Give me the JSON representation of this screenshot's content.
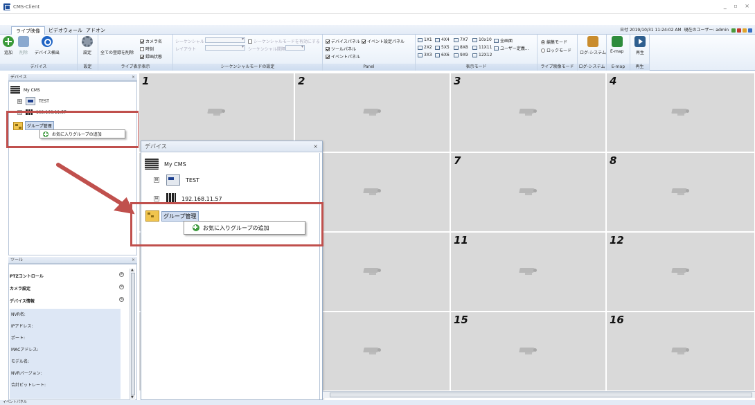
{
  "window": {
    "title": "CMS-Client",
    "controls": "_ ▫ ×"
  },
  "tabs": [
    {
      "label": "ライブ映像",
      "active": true
    },
    {
      "label": "ビデオウォール",
      "active": false
    },
    {
      "label": "アドオン",
      "active": false
    }
  ],
  "header_status": {
    "date_label": "日付",
    "datetime": "2019/10/31 11:24:02",
    "badge": "AM",
    "user_label": "現在のユーザー:",
    "user": "admin"
  },
  "ribbon": {
    "device_group": {
      "label": "デバイス",
      "add": "追加",
      "delete": "削除",
      "detect": "デバイス検出"
    },
    "settings_group": {
      "label": "設定",
      "settings": "設定"
    },
    "display_group": {
      "label": "ライブ表示表示",
      "clear_all": "全ての登録を削除",
      "camera_name": "カメラ名",
      "time": "時刻",
      "record_status": "録画状態"
    },
    "sequence_group": {
      "label": "シーケンシャルモードの設定",
      "sequential": "シーケンシャル",
      "layout": "レイアウト",
      "enable_sequential": "シーケンシャルモードを有効にする",
      "sequential_interval": "シーケンシャル間隔"
    },
    "panel_group": {
      "label": "Panel",
      "device_panel": "デバイスパネル",
      "event_settings_panel": "イベント設定パネル",
      "tool_panel": "ツールパネル",
      "event_panel": "イベントパネル"
    },
    "view_group": {
      "label": "表示モード",
      "modes": [
        [
          "1X1",
          "4X4",
          "7X7",
          "10x10",
          "全画面"
        ],
        [
          "2X2",
          "5X5",
          "8X8",
          "11X11",
          "ユーザー定義..."
        ],
        [
          "3X3",
          "6X6",
          "9X9",
          "12X12"
        ]
      ]
    },
    "live_mode_group": {
      "label": "ライブ映像モード",
      "edit_mode": "編集モード",
      "lock_mode": "ロックモード"
    },
    "log_group": {
      "label": "ログ-システム",
      "button": "ログ-システム"
    },
    "emap_group": {
      "label": "E-map",
      "button": "E-map"
    },
    "playback_group": {
      "label": "再生",
      "button": "再生"
    }
  },
  "device_panel": {
    "title": "デバイス",
    "close": "×",
    "root": "My CMS",
    "test_node": "TEST",
    "ip_node": "192.168.11.57",
    "expand": "⊞",
    "group_node": "グループ管理",
    "context_menu": "お気に入りグループの追加"
  },
  "tool_panel": {
    "title": "ツール",
    "close": "×",
    "sections": [
      "PTZコントロール",
      "カメラ設定",
      "デバイス情報"
    ],
    "chevrons": [
      "≫",
      "≫",
      "≪"
    ],
    "info_fields": [
      "NVR名:",
      "IPアドレス:",
      "ポート:",
      "MACアドレス:",
      "モデル名:",
      "NVRバージョン:",
      "合計ビットレート:"
    ]
  },
  "grid": {
    "cells": [
      {
        "num": "1"
      },
      {
        "num": "2"
      },
      {
        "num": "3"
      },
      {
        "num": "4"
      },
      {
        "num": ""
      },
      {
        "num": ""
      },
      {
        "num": "7"
      },
      {
        "num": "8"
      },
      {
        "num": ""
      },
      {
        "num": ""
      },
      {
        "num": "11"
      },
      {
        "num": "12"
      },
      {
        "num": ""
      },
      {
        "num": ""
      },
      {
        "num": "15"
      },
      {
        "num": "16"
      }
    ]
  },
  "statusbar": {
    "text": "イベントパネル"
  },
  "colors": {
    "highlight": "#c0504d",
    "cell_bg": "#d9d9d9",
    "ribbon_accent": "#1f4f9a"
  }
}
